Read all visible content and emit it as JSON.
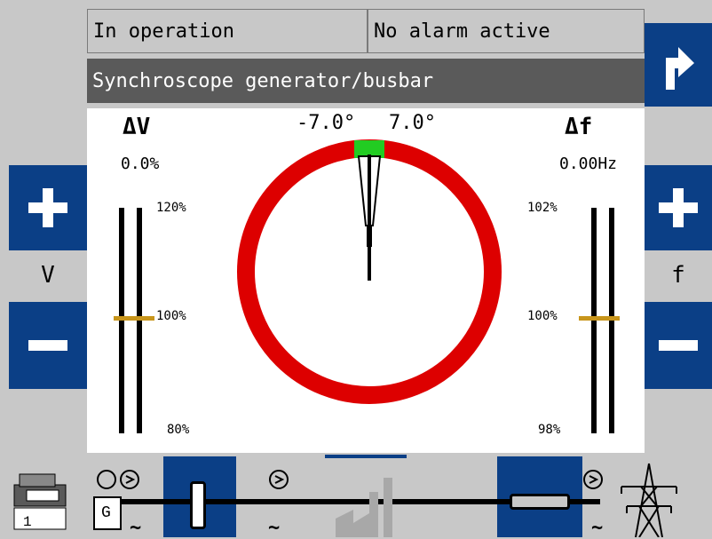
{
  "status": {
    "operation": "In operation",
    "alarm": "No alarm active"
  },
  "screen_title": "Synchroscope generator/busbar",
  "voltage": {
    "delta_label": "ΔV",
    "delta_value": "0.0%",
    "scale_top": "120%",
    "scale_mid": "100%",
    "scale_bottom": "80%",
    "side_label": "V",
    "level_percent": 100
  },
  "frequency": {
    "delta_label": "Δf",
    "delta_value": "0.00Hz",
    "scale_top": "102%",
    "scale_mid": "100%",
    "scale_bottom": "98%",
    "side_label": "f",
    "level_percent": 100
  },
  "synchroscope": {
    "angle_left": "-7.0°",
    "angle_right": "7.0°",
    "phase_angle_deg": 0,
    "window_deg": 7.0,
    "ring_color": "#dd0000",
    "window_color": "#22cc22"
  },
  "icons": {
    "exit": "exit-arrow-icon",
    "plus": "plus-icon",
    "minus": "minus-icon",
    "generator": "generator-icon",
    "busbar": "busbar-icon",
    "mains": "transmission-tower-icon",
    "load": "load-icon"
  },
  "bottom": {
    "gen_number": "1",
    "ac_symbol": "~",
    "gen_letter": "G"
  }
}
